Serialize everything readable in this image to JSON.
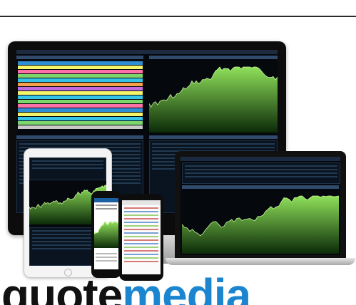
{
  "logo": {
    "part1": "quote",
    "part2": "media",
    "color1": "#111111",
    "color2": "#1b86cf"
  },
  "colors": {
    "chart_fill_top": "#8fe05a",
    "chart_fill_bottom": "#0b2a08",
    "chart_line": "#c6f79b",
    "panel_bg": "#05080d",
    "header": "#2f4a6b"
  },
  "grid_row_colors": [
    "#2f8fd6",
    "#f5f56a",
    "#ff6fa8",
    "#7dd66b",
    "#35c4e8",
    "#f5a04a",
    "#c06be0",
    "#f5f56a",
    "#35c4e8",
    "#7dd66b",
    "#ff6fa8",
    "#2f8fd6",
    "#f5f56a",
    "#35c4e8",
    "#7dd66b",
    "#c9c9c9"
  ],
  "devices": [
    "monitor",
    "laptop",
    "tablet",
    "phone-left",
    "phone-right"
  ]
}
